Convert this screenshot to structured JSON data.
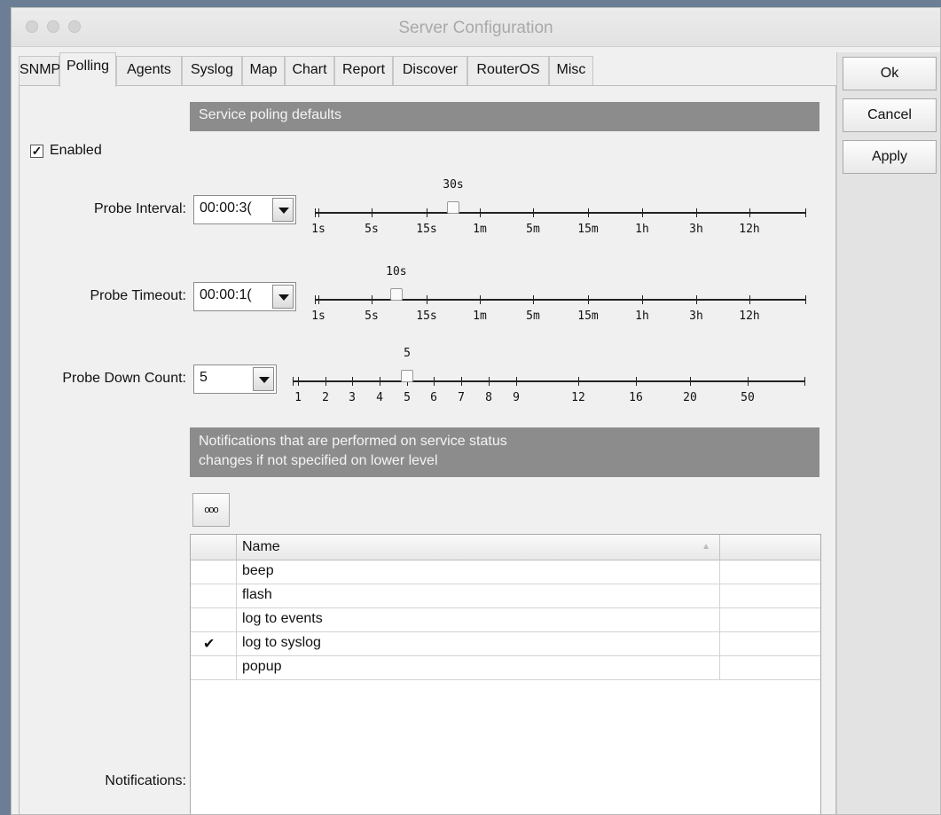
{
  "window": {
    "title": "Server Configuration"
  },
  "tabs": [
    {
      "label": "SNMP",
      "active": false
    },
    {
      "label": "Polling",
      "active": true
    },
    {
      "label": "Agents",
      "active": false
    },
    {
      "label": "Syslog",
      "active": false
    },
    {
      "label": "Map",
      "active": false
    },
    {
      "label": "Chart",
      "active": false
    },
    {
      "label": "Report",
      "active": false
    },
    {
      "label": "Discover",
      "active": false
    },
    {
      "label": "RouterOS",
      "active": false
    },
    {
      "label": "Misc",
      "active": false
    }
  ],
  "buttons": {
    "ok": "Ok",
    "cancel": "Cancel",
    "apply": "Apply"
  },
  "service_polling": {
    "banner": "Service poling defaults",
    "enabled_label": "Enabled",
    "enabled": true,
    "probe_interval": {
      "label": "Probe Interval:",
      "value": "00:00:3(",
      "slider_value": "30s",
      "ticks": [
        "1s",
        "5s",
        "15s",
        "1m",
        "5m",
        "15m",
        "1h",
        "3h",
        "12h"
      ]
    },
    "probe_timeout": {
      "label": "Probe Timeout:",
      "value": "00:00:1(",
      "slider_value": "10s",
      "ticks": [
        "1s",
        "5s",
        "15s",
        "1m",
        "5m",
        "15m",
        "1h",
        "3h",
        "12h"
      ]
    },
    "probe_down_count": {
      "label": "Probe Down Count:",
      "value": "5",
      "slider_value": "5",
      "ticks": [
        "1",
        "2",
        "3",
        "4",
        "5",
        "6",
        "7",
        "8",
        "9",
        "12",
        "16",
        "20",
        "50"
      ]
    }
  },
  "notifications": {
    "banner_line1": "Notifications that are performed on service status",
    "banner_line2": "changes if not specified on lower level",
    "button_label": "ooo",
    "label": "Notifications:",
    "column_name": "Name",
    "sort_indicator": "▲",
    "items": [
      {
        "name": "beep",
        "check": ""
      },
      {
        "name": "flash",
        "check": ""
      },
      {
        "name": "log to events",
        "check": ""
      },
      {
        "name": "log to syslog",
        "check": "✔"
      },
      {
        "name": "popup",
        "check": ""
      }
    ]
  }
}
